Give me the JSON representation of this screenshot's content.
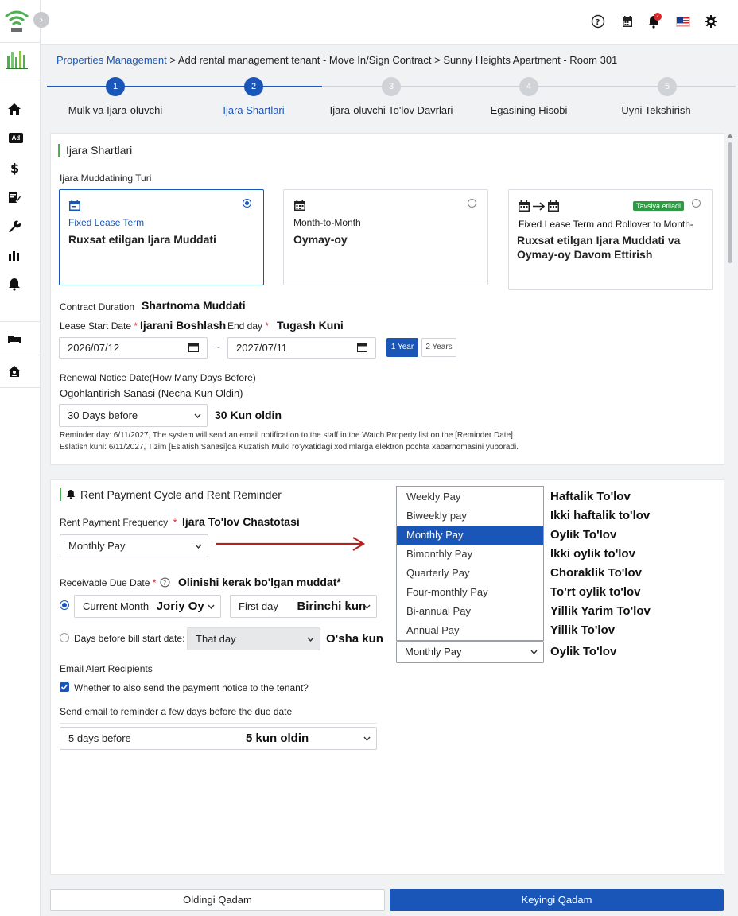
{
  "breadcrumb": {
    "link": "Properties Management",
    "rest": " > Add rental management tenant - Move In/Sign Contract > Sunny Heights Apartment - Room 301"
  },
  "steps": [
    {
      "num": "1",
      "label": "Mulk va Ijara-oluvchi"
    },
    {
      "num": "2",
      "label": "Ijara Shartlari"
    },
    {
      "num": "3",
      "label": "Ijara-oluvchi To'lov Davrlari"
    },
    {
      "num": "4",
      "label": "Egasining Hisobi"
    },
    {
      "num": "5",
      "label": "Uyni Tekshirish"
    }
  ],
  "notification_count": "7",
  "lease": {
    "section_title": "Ijara Shartlari",
    "term_type_label": "Ijara Muddatining Turi",
    "options": [
      {
        "en": "Fixed Lease Term",
        "uz": "Ruxsat etilgan Ijara Muddati"
      },
      {
        "en": "Month-to-Month",
        "uz": "Oymay-oy"
      },
      {
        "en": "Fixed Lease Term and Rollover to Month-",
        "uz": "Ruxsat etilgan Ijara Muddati va Oymay-oy Davom Ettirish"
      }
    ],
    "recommended_tag": "Tavsiya etiladi",
    "duration_en": "Contract Duration",
    "duration_uz": "Shartnoma Muddati",
    "start_en": "Lease Start Date",
    "start_uz": "Ijarani Boshlash",
    "end_en": "End day",
    "end_uz": "Tugash Kuni",
    "start_value": "2026/07/12",
    "end_value": "2027/07/11",
    "tilde": "~",
    "btn_1year": "1 Year",
    "btn_2years": "2 Years",
    "renewal_en": "Renewal Notice Date(How Many Days Before)",
    "renewal_uz": "Ogohlantirish Sanasi (Necha Kun Oldin)",
    "renewal_value": "30 Days before",
    "renewal_uz_value": "30 Kun oldin",
    "reminder_en": "Reminder day: 6/11/2027, The system will send an email notification to the staff in the Watch Property list on the [Reminder Date].",
    "reminder_uz": "Eslatish kuni: 6/11/2027, Tizim [Eslatish Sanasi]da Kuzatish Mulki ro'yxatidagi xodimlarga elektron pochta xabarnomasini yuboradi."
  },
  "rent": {
    "section_title": "Rent Payment Cycle and Rent Reminder",
    "freq_en": "Rent Payment Frequency",
    "freq_uz": "Ijara To'lov Chastotasi",
    "freq_value": "Monthly Pay",
    "due_en": "Receivable Due Date",
    "due_uz": "Olinishi kerak bo'lgan muddat*",
    "current_month": "Current Month",
    "current_month_uz": "Joriy Oy",
    "first_day": "First day",
    "first_day_uz": "Birinchi kun",
    "days_before_label": "Days before bill start date:",
    "that_day": "That day",
    "that_day_uz": "O'sha kun",
    "email_label": "Email Alert Recipients",
    "checkbox_label": "Whether to also send the payment notice to the tenant?",
    "send_label": "Send email to reminder a few days before the due date",
    "days_value": "5 days before",
    "days_value_uz": "5 kun oldin"
  },
  "dropdown": {
    "items": [
      "Weekly Pay",
      "Biweekly pay",
      "Monthly Pay",
      "Bimonthly Pay",
      "Quarterly Pay",
      "Four-monthly Pay",
      "Bi-annual Pay",
      "Annual Pay"
    ],
    "selected": "Monthly Pay",
    "translations": [
      "Haftalik To'lov",
      "Ikki haftalik to'lov",
      "Oylik To'lov",
      "Ikki oylik to'lov",
      "Choraklik To'lov",
      "To'rt oylik to'lov",
      "Yillik Yarim To'lov",
      "Yillik To'lov"
    ],
    "selected_translation": "Oylik To'lov"
  },
  "buttons": {
    "prev": "Oldingi Qadam",
    "next": "Keyingi Qadam"
  }
}
